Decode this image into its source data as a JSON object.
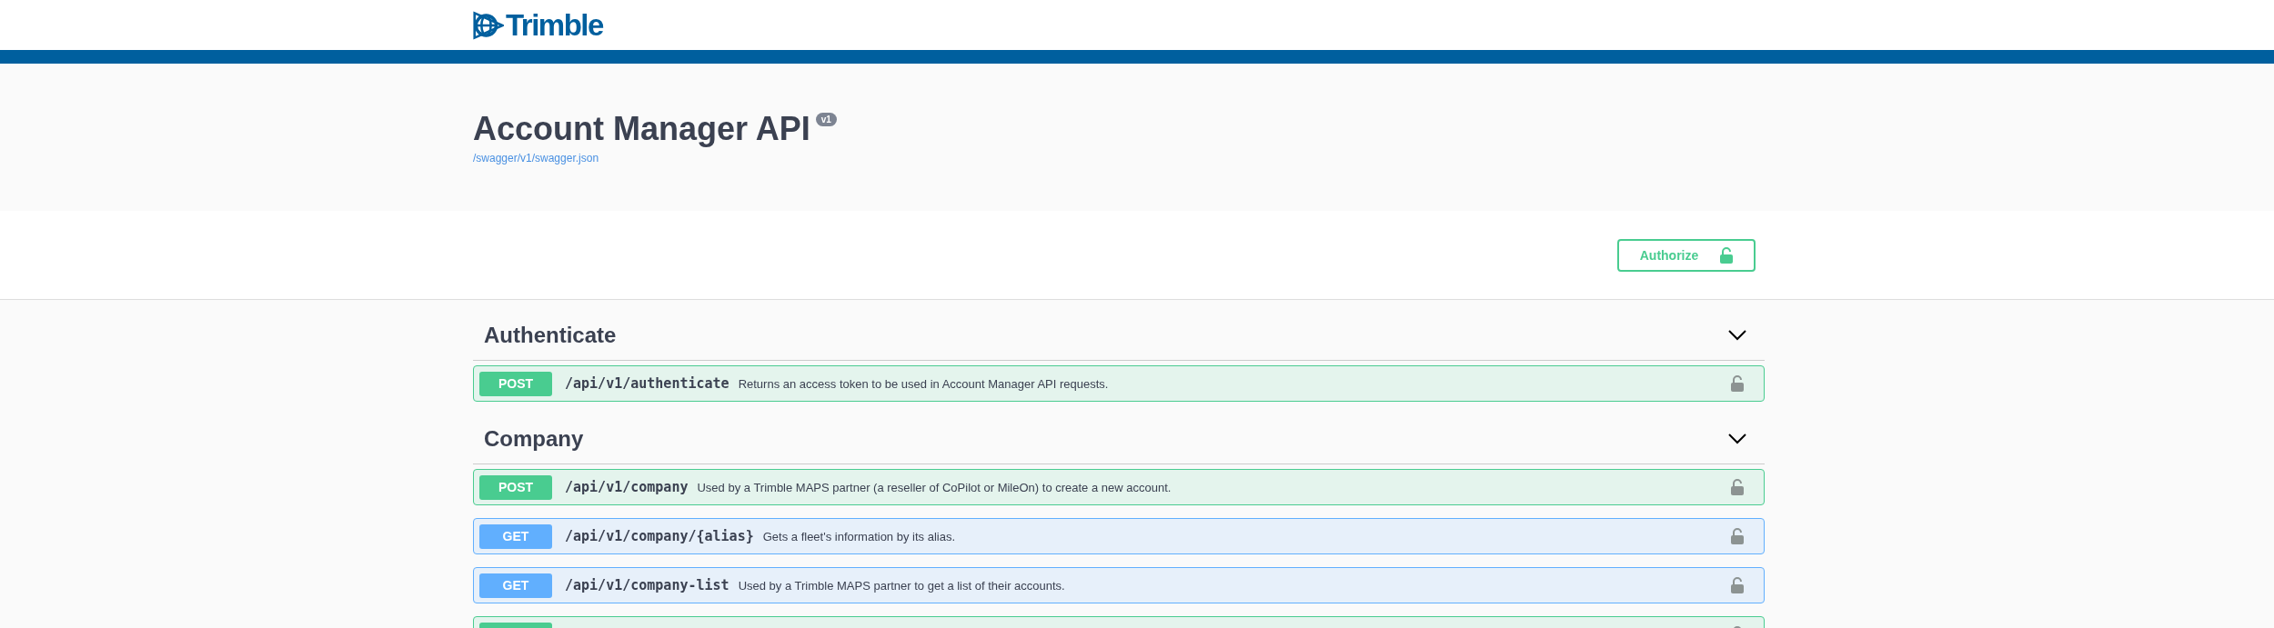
{
  "header": {
    "logo_text": "Trimble"
  },
  "info": {
    "title": "Account Manager API",
    "version": "v1",
    "spec_link": "/swagger/v1/swagger.json"
  },
  "authorize_button": {
    "label": "Authorize"
  },
  "sections": [
    {
      "name": "Authenticate",
      "expanded": true,
      "operations": [
        {
          "method": "POST",
          "kind": "post",
          "path": "/api/v1/authenticate",
          "summary": "Returns an access token to be used in Account Manager API requests."
        }
      ]
    },
    {
      "name": "Company",
      "expanded": true,
      "operations": [
        {
          "method": "POST",
          "kind": "post",
          "path": "/api/v1/company",
          "summary": "Used by a Trimble MAPS partner (a reseller of CoPilot or MileOn) to create a new account."
        },
        {
          "method": "GET",
          "kind": "get",
          "path": "/api/v1/company/{alias}",
          "summary": "Gets a fleet's information by its alias."
        },
        {
          "method": "GET",
          "kind": "get",
          "path": "/api/v1/company-list",
          "summary": "Used by a Trimble MAPS partner to get a list of their accounts."
        },
        {
          "kind": "post"
        }
      ]
    }
  ]
}
